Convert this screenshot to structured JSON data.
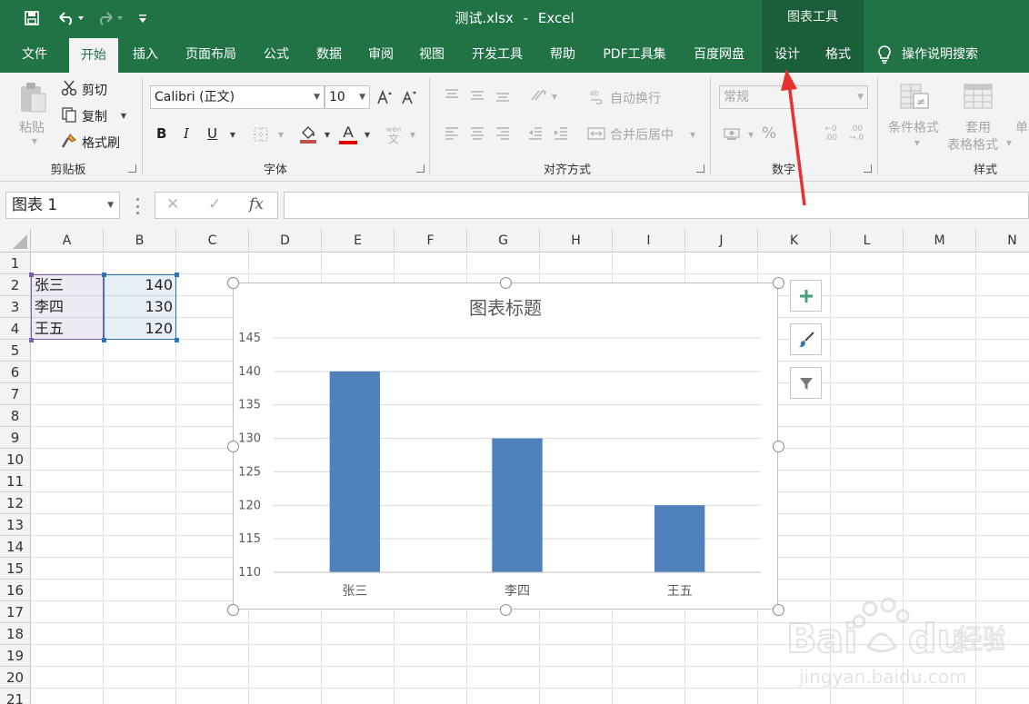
{
  "window": {
    "file_name": "测试.xlsx",
    "separator": "-",
    "app_name": "Excel",
    "context_tools_label": "图表工具"
  },
  "quick_access": {
    "save_icon": "save-icon",
    "undo_icon": "undo-icon",
    "redo_icon": "redo-icon",
    "customize_icon": "customize-arrow-icon"
  },
  "tabs": [
    {
      "label": "文件"
    },
    {
      "label": "开始",
      "active": true
    },
    {
      "label": "插入"
    },
    {
      "label": "页面布局"
    },
    {
      "label": "公式"
    },
    {
      "label": "数据"
    },
    {
      "label": "审阅"
    },
    {
      "label": "视图"
    },
    {
      "label": "开发工具"
    },
    {
      "label": "帮助"
    },
    {
      "label": "PDF工具集"
    },
    {
      "label": "百度网盘"
    },
    {
      "label": "设计",
      "context": true
    },
    {
      "label": "格式",
      "context": true
    }
  ],
  "tell_me": {
    "label": "操作说明搜索",
    "icon": "lightbulb-icon"
  },
  "ribbon": {
    "clipboard": {
      "group_label": "剪贴板",
      "paste": "粘贴",
      "cut": "剪切",
      "copy": "复制",
      "format_painter": "格式刷"
    },
    "font": {
      "group_label": "字体",
      "font_name": "Calibri (正文)",
      "font_size": "10",
      "bold": "B",
      "italic": "I",
      "underline": "U",
      "font_color_glyph": "A",
      "phonetic": "wén",
      "font_color": "#e00000"
    },
    "alignment": {
      "group_label": "对齐方式",
      "wrap_text": "自动换行",
      "merge_center": "合并后居中"
    },
    "number": {
      "group_label": "数字",
      "format": "常规",
      "percent": "%"
    },
    "styles": {
      "group_label": "样式",
      "conditional_formatting": "条件格式",
      "format_as_table_1": "套用",
      "format_as_table_2": "表格格式",
      "cell_styles_partial": "单"
    }
  },
  "formula_bar": {
    "name_box": "图表 1",
    "cancel": "✕",
    "enter": "✓",
    "fx": "fx"
  },
  "sheet": {
    "columns": [
      "A",
      "B",
      "C",
      "D",
      "E",
      "F",
      "G",
      "H",
      "I",
      "J",
      "K",
      "L",
      "M",
      "N"
    ],
    "rows": [
      "1",
      "2",
      "3",
      "4",
      "5",
      "6",
      "7",
      "8",
      "9",
      "10",
      "11",
      "12",
      "13",
      "14",
      "15",
      "16",
      "17",
      "18",
      "19",
      "20",
      "21"
    ],
    "data": [
      {
        "row": "2",
        "a": "张三",
        "b": "140"
      },
      {
        "row": "3",
        "a": "李四",
        "b": "130"
      },
      {
        "row": "4",
        "a": "王五",
        "b": "120"
      }
    ]
  },
  "chart_data": {
    "type": "bar",
    "title": "图表标题",
    "categories": [
      "张三",
      "李四",
      "王五"
    ],
    "values": [
      140,
      130,
      120
    ],
    "ylim": [
      110,
      145
    ],
    "yticks": [
      110,
      115,
      120,
      125,
      130,
      135,
      140,
      145
    ],
    "grid": true,
    "bar_color": "#4f81bd"
  },
  "chart_side_buttons": [
    "chart-elements-icon",
    "chart-styles-icon",
    "chart-filters-icon"
  ],
  "colors": {
    "excel_green": "#217346",
    "context_green": "#1b5e3a",
    "ribbon_bg": "#f3f3f3",
    "selection_purple": "#7f5fa9",
    "selection_blue": "#2e75b6",
    "annotation_arrow": "#e8322f"
  }
}
